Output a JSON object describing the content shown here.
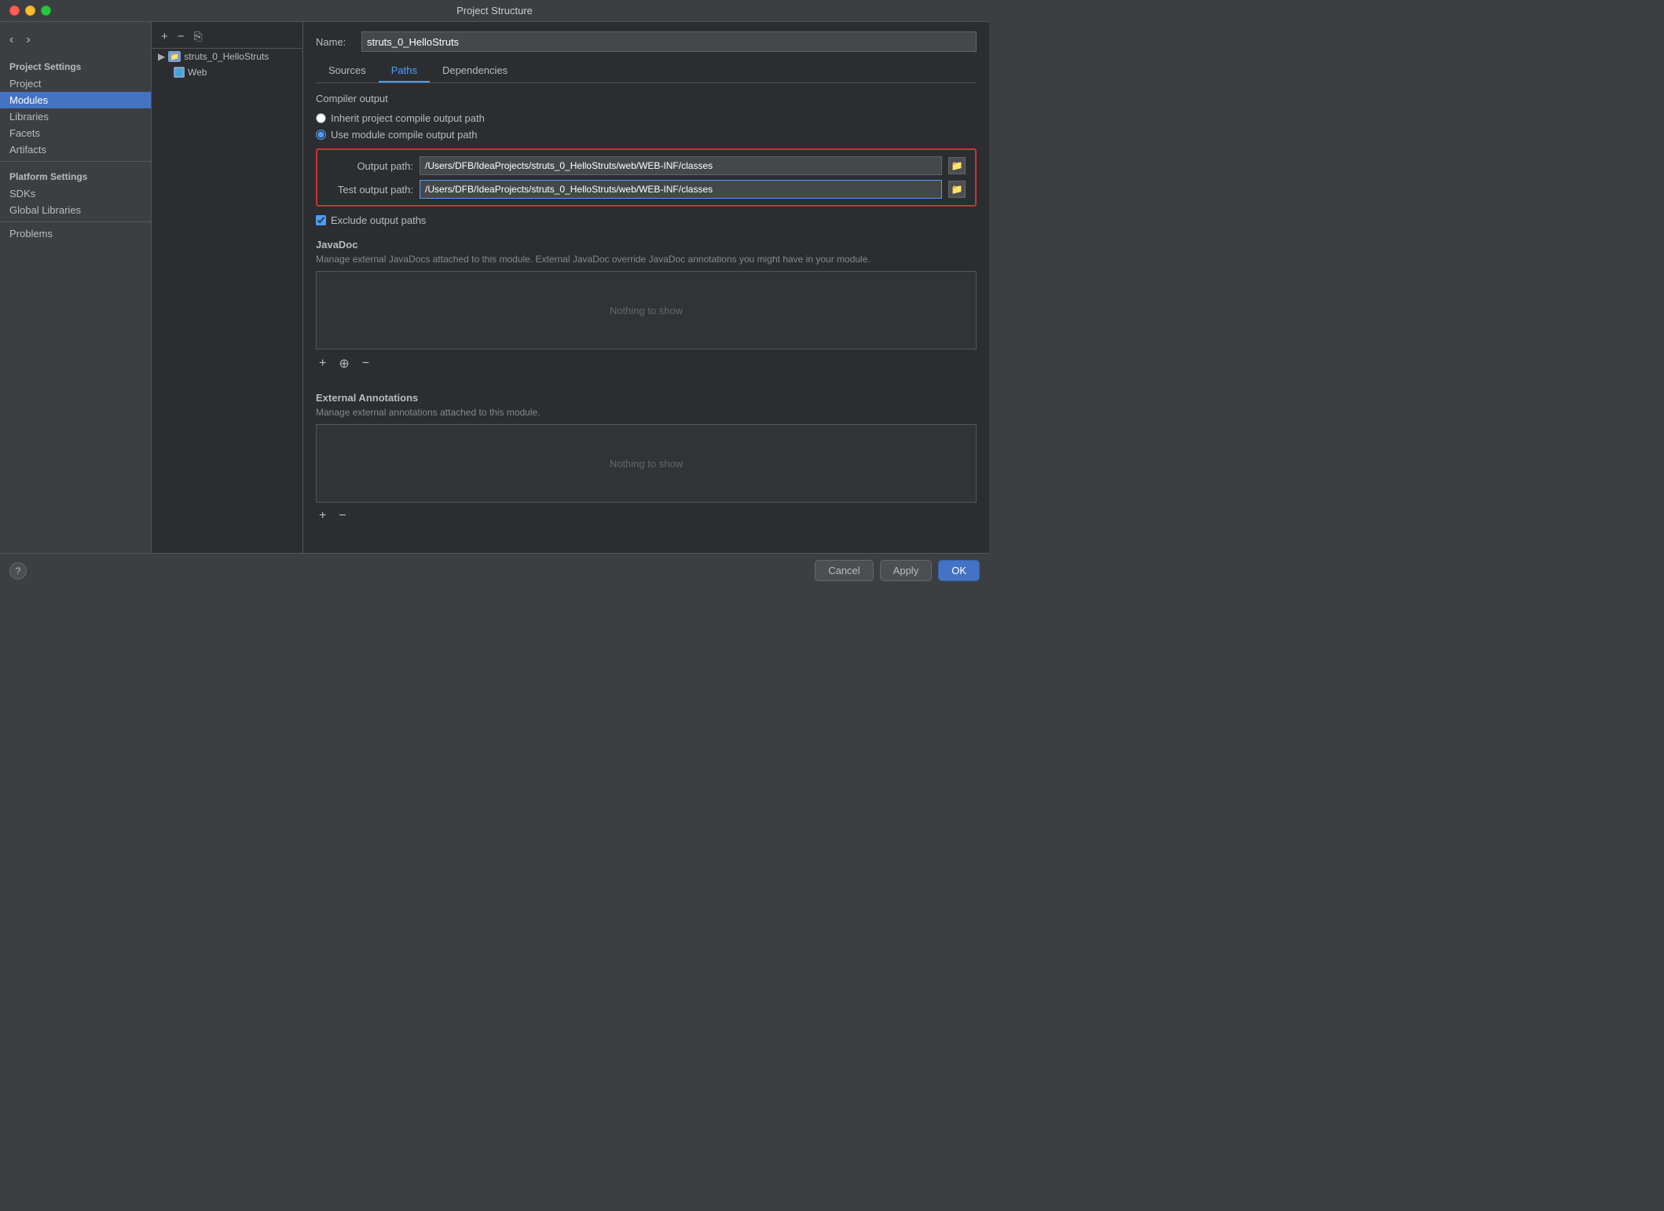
{
  "window": {
    "title": "Project Structure"
  },
  "titlebar": {
    "close": "×",
    "minimize": "−",
    "maximize": "+"
  },
  "nav": {
    "back": "‹",
    "forward": "›"
  },
  "sidebar": {
    "project_settings_label": "Project Settings",
    "items": [
      {
        "id": "project",
        "label": "Project",
        "active": false
      },
      {
        "id": "modules",
        "label": "Modules",
        "active": true
      },
      {
        "id": "libraries",
        "label": "Libraries",
        "active": false
      },
      {
        "id": "facets",
        "label": "Facets",
        "active": false
      },
      {
        "id": "artifacts",
        "label": "Artifacts",
        "active": false
      }
    ],
    "platform_settings_label": "Platform Settings",
    "platform_items": [
      {
        "id": "sdks",
        "label": "SDKs"
      },
      {
        "id": "global_libraries",
        "label": "Global Libraries"
      }
    ],
    "other_items": [
      {
        "id": "problems",
        "label": "Problems"
      }
    ]
  },
  "modules_tree": {
    "module_name": "struts_0_HelloStruts",
    "child": "Web"
  },
  "toolbar": {
    "add": "+",
    "remove": "−",
    "copy": "⎘"
  },
  "content": {
    "name_label": "Name:",
    "name_value": "struts_0_HelloStruts",
    "tabs": [
      {
        "id": "sources",
        "label": "Sources"
      },
      {
        "id": "paths",
        "label": "Paths",
        "active": true
      },
      {
        "id": "dependencies",
        "label": "Dependencies"
      }
    ],
    "compiler_output": {
      "section_title": "Compiler output",
      "radio1_label": "Inherit project compile output path",
      "radio2_label": "Use module compile output path",
      "output_path_label": "Output path:",
      "output_path_value": "/Users/DFB/IdeaProjects/struts_0_HelloStruts/web/WEB-INF/classes",
      "test_output_path_label": "Test output path:",
      "test_output_path_value": "/Users/DFB/IdeaProjects/struts_0_HelloStruts/web/WEB-INF/classes",
      "exclude_label": "Exclude output paths"
    },
    "javadoc": {
      "title": "JavaDoc",
      "description": "Manage external JavaDocs attached to this module. External JavaDoc override JavaDoc annotations you might have in your module.",
      "nothing_to_show": "Nothing to show"
    },
    "external_annotations": {
      "title": "External Annotations",
      "description": "Manage external annotations attached to this module.",
      "nothing_to_show": "Nothing to show"
    }
  },
  "bottom": {
    "help_label": "?",
    "cancel_label": "Cancel",
    "apply_label": "Apply",
    "ok_label": "OK"
  }
}
